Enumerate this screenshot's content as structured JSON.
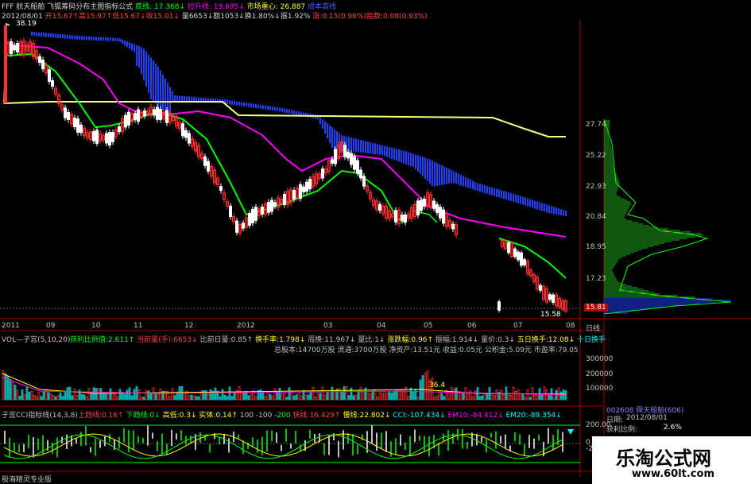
{
  "header": {
    "line1": [
      {
        "text": "FFF 航天船舶 飞狐筹码分布主图指标公式",
        "color": "#d8d8d8"
      },
      {
        "text": "底线:",
        "color": "#00ff00"
      },
      {
        "text": "17.368↓",
        "color": "#00ff00"
      },
      {
        "text": "拉升线:",
        "color": "#ff00ff"
      },
      {
        "text": "19.695↓",
        "color": "#ff00ff"
      },
      {
        "text": "市场重心:",
        "color": "#ffff00"
      },
      {
        "text": "26.887",
        "color": "#ffff00"
      },
      {
        "text": "成本高线",
        "color": "#4060ff"
      }
    ],
    "line2": [
      {
        "text": "2012/08/01",
        "color": "#d0d0d0"
      },
      {
        "text": "开15.67↑高15.97↑低15.67↓收15.01↓",
        "color": "#ff4040"
      },
      {
        "text": "量6653↓额1053↓换1.80%↓振1.92%",
        "color": "#d0d0d0"
      },
      {
        "text": "涨:0.15(0.96%)指数:0.08(0.93%)",
        "color": "#ff4040"
      }
    ]
  },
  "main_chart": {
    "top_label": "38.19",
    "low_label": "15.58",
    "price_axis": [
      "27.74",
      "25.22",
      "22.93",
      "20.84",
      "18.95",
      "17.23"
    ],
    "current_price": "15.81",
    "x_axis": [
      "2011",
      "09",
      "10",
      "11",
      "12",
      "2012",
      "03",
      "04",
      "05",
      "06",
      "07",
      "08"
    ],
    "period_label": "日线",
    "colors": {
      "up": "#ff3030",
      "down": "#ffffff",
      "support": "#00ff00",
      "pull": "#ff00ff",
      "center": "#ffff80",
      "cost": "#2040ff"
    }
  },
  "volume_panel": {
    "title": "VOL—子宫(5,10,20)",
    "stats": [
      {
        "text": "获利比例值:2.611↑",
        "color": "#00ff00"
      },
      {
        "text": "当前量(手):6653↓",
        "color": "#ff4040"
      },
      {
        "text": "比前日量:0.85↑",
        "color": "#c0c0c0"
      },
      {
        "text": "换手率:1.798↓",
        "color": "#ffff00"
      },
      {
        "text": "周换:11.967↓",
        "color": "#c0c0c0"
      },
      {
        "text": "量比:1↓",
        "color": "#c0c0c0"
      },
      {
        "text": "涨跌幅:0.96↑",
        "color": "#ffff00"
      },
      {
        "text": "振幅:1.914↓",
        "color": "#c0c0c0"
      },
      {
        "text": "量价:0.3↓",
        "color": "#c0c0c0"
      },
      {
        "text": "五日换手:12.08↓",
        "color": "#ffff00"
      },
      {
        "text": "十日换手",
        "color": "#00ffff"
      }
    ],
    "fundamentals": "总股本:14700万股  流通:3700万股  净资产:13.51元  收益:0.05元  公积金:5.09元  市盈率:79.05",
    "axis": [
      "300000",
      "200000",
      "100000"
    ],
    "peak_label": "36.4"
  },
  "cci_panel": {
    "title": "子宫CCI指标线(14,3,8)",
    "items": [
      {
        "text": "上趋线:0.16↑",
        "color": "#ff4040"
      },
      {
        "text": "下趋线:0↓",
        "color": "#00ff00"
      },
      {
        "text": "高低:0.3↓",
        "color": "#ffff00"
      },
      {
        "text": "实体:0.14↑",
        "color": "#ffff00"
      },
      {
        "text": "100",
        "color": "#c0c0c0"
      },
      {
        "text": "-100",
        "color": "#c0c0c0"
      },
      {
        "text": "-200",
        "color": "#00ff00"
      },
      {
        "text": "快线:16.429↑",
        "color": "#ff4040"
      },
      {
        "text": "慢线:22.802↓",
        "color": "#ffff00"
      },
      {
        "text": "CCI:-107.434↓",
        "color": "#00ffff"
      },
      {
        "text": "EM10:-84.412↓",
        "color": "#ff00ff"
      },
      {
        "text": "EM20:-89.354↓",
        "color": "#00ffff"
      }
    ],
    "axis": [
      "200.00",
      "0.00",
      "-200"
    ]
  },
  "side_panel": {
    "code": "002608 舜天船舶(606)",
    "date_label": "日期:",
    "date": "2012/08/01",
    "profit_label": "获利比例:",
    "profit": "2.6%"
  },
  "footer": "股海精灵专业版",
  "watermark": {
    "title": "乐淘公式网",
    "url": "www.60lt.com"
  }
}
